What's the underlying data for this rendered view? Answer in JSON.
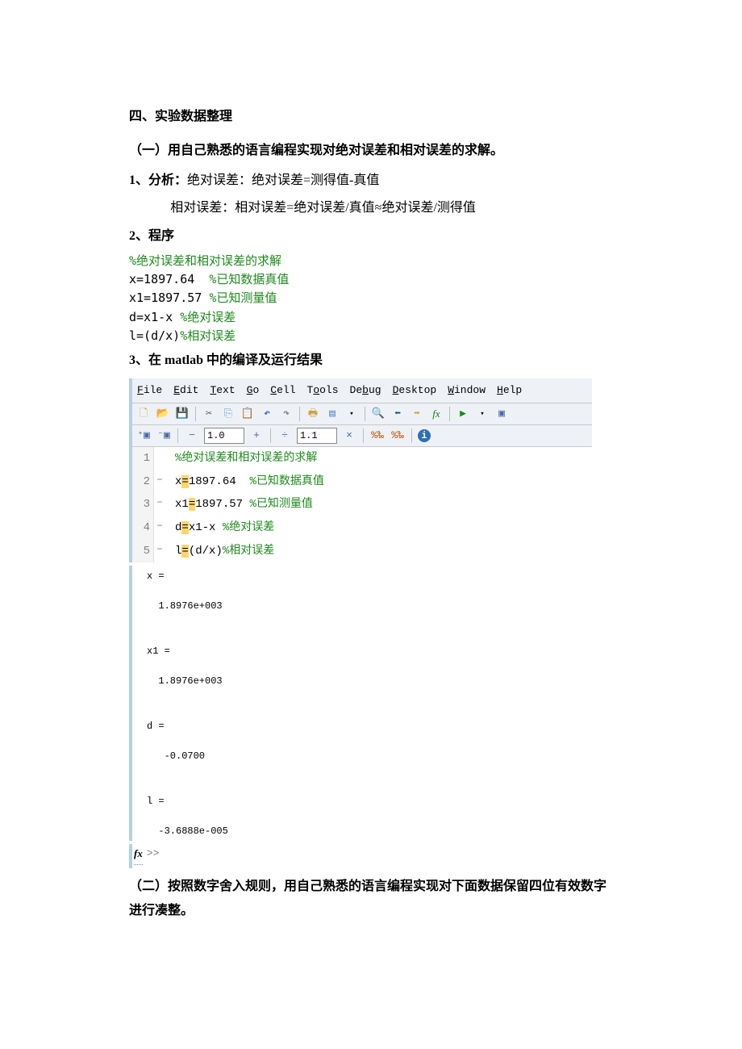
{
  "doc": {
    "h4": "四、实验数据整理",
    "p1": "（一）用自己熟悉的语言编程实现对绝对误差和相对误差的求解。",
    "item1_label": "1、分析：",
    "item1_text": "绝对误差：绝对误差=测得值-真值",
    "item1_text2": "相对误差：相对误差=绝对误差/真值≈绝对误差/测得值",
    "item2": "2、程序",
    "code": {
      "l1c": "%绝对误差和相对误差的求解",
      "l2a": "x=1897.64  ",
      "l2b": "%已知数据真值",
      "l3a": "x1=1897.57 ",
      "l3b": "%已知测量值",
      "l4a": "d=x1-x ",
      "l4b": "%绝对误差",
      "l5a": "l=(d/x)",
      "l5b": "%相对误差"
    },
    "item3": "3、在 matlab 中的编译及运行结果",
    "p2": "（二）按照数字舍入规则，用自己熟悉的语言编程实现对下面数据保留四位有效数字进行凑整。"
  },
  "menu": {
    "file": "File",
    "edit": "Edit",
    "text": "Text",
    "go": "Go",
    "cell": "Cell",
    "tools": "Tools",
    "debug": "Debug",
    "desktop": "Desktop",
    "window": "Window",
    "help": "Help"
  },
  "toolbar2": {
    "box1": "1.0",
    "box2": "1.1"
  },
  "editor": {
    "l1": {
      "n": "1",
      "comment": "%绝对误差和相对误差的求解"
    },
    "l2": {
      "n": "2",
      "a": "x",
      "eq": "=",
      "b": "1897.64  ",
      "c": "%已知数据真值"
    },
    "l3": {
      "n": "3",
      "a": "x1",
      "eq": "=",
      "b": "1897.57 ",
      "c": "%已知测量值"
    },
    "l4": {
      "n": "4",
      "a": "d",
      "eq": "=",
      "b": "x1-x ",
      "c": "%绝对误差"
    },
    "l5": {
      "n": "5",
      "a": "l",
      "eq": "=",
      "b": "(d/x)",
      "c": "%相对误差"
    }
  },
  "cmd": {
    "out": "x =\n\n  1.8976e+003\n\n\nx1 =\n\n  1.8976e+003\n\n\nd =\n\n   -0.0700\n\n\nl =\n\n  -3.6888e-005\n",
    "fx": "fx",
    "prompt": ">>"
  }
}
